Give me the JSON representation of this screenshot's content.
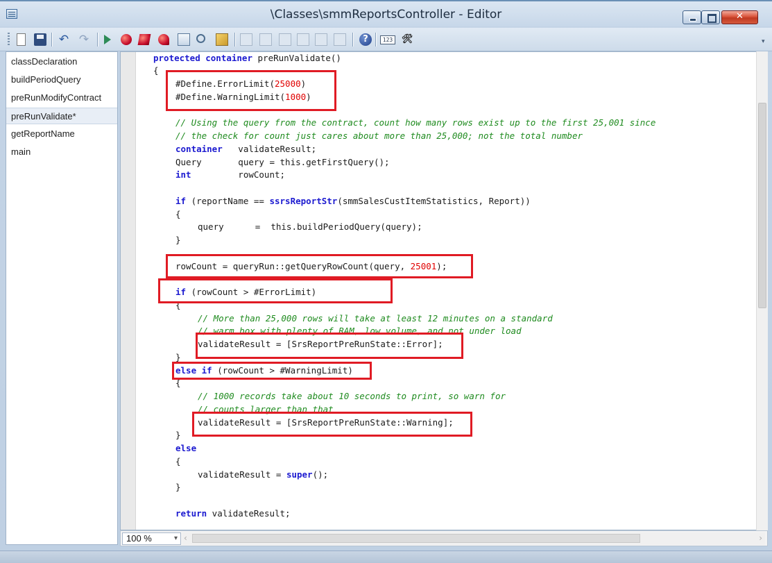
{
  "window": {
    "title": "\\Classes\\smmReportsController - Editor"
  },
  "toolbar": {
    "help_glyph": "?",
    "number_glyph": "123",
    "macro_glyph": "&lt;/&gt;",
    "undo_glyph": "↶",
    "redo_glyph": "↷",
    "overflow_glyph": "▾"
  },
  "methods": [
    {
      "label": "classDeclaration",
      "selected": false
    },
    {
      "label": "buildPeriodQuery",
      "selected": false
    },
    {
      "label": "preRunModifyContract",
      "selected": false
    },
    {
      "label": "preRunValidate*",
      "selected": true
    },
    {
      "label": "getReportName",
      "selected": false
    },
    {
      "label": "main",
      "selected": false
    }
  ],
  "code": {
    "l01_kw": "protected container",
    "l01_rest": " preRunValidate()",
    "l02": "{",
    "l03_a": "#Define.ErrorLimit(",
    "l03_n": "25000",
    "l03_b": ")",
    "l04_a": "#Define.WarningLimit(",
    "l04_n": "1000",
    "l04_b": ")",
    "l06": "// Using the query from the contract, count how many rows exist up to the first 25,001 since",
    "l07": "// the check for count just cares about more than 25,000; not the total number",
    "l08_kw": "container",
    "l08_rest": "   validateResult;",
    "l09": "Query       query = this.getFirstQuery();",
    "l10_kw": "int",
    "l10_rest": "         rowCount;",
    "l12_kw": "if",
    "l12_a": " (reportName == ",
    "l12_kw2": "ssrsReportStr",
    "l12_b": "(smmSalesCustItemStatistics, Report))",
    "l13": "{",
    "l14": "query      =  this.buildPeriodQuery(query);",
    "l15": "}",
    "l17_a": "rowCount = queryRun::getQueryRowCount(query, ",
    "l17_n": "25001",
    "l17_b": ");",
    "l19_kw": "if",
    "l19_rest": " (rowCount > #ErrorLimit)",
    "l20": "{",
    "l21": "// More than 25,000 rows will take at least 12 minutes on a standard",
    "l22": "// warm box with plenty of RAM, low volume, and not under load",
    "l23": "validateResult = [SrsReportPreRunState::Error];",
    "l24": "}",
    "l25_kw": "else if",
    "l25_rest": " (rowCount > #WarningLimit)",
    "l26": "{",
    "l27": "// 1000 records take about 10 seconds to print, so warn for",
    "l28": "// counts larger than that",
    "l29": "validateResult = [SrsReportPreRunState::Warning];",
    "l30": "}",
    "l31_kw": "else",
    "l32": "{",
    "l33_a": "validateResult = ",
    "l33_kw": "super",
    "l33_b": "();",
    "l34": "}",
    "l36_kw": "return",
    "l36_rest": " validateResult;"
  },
  "zoom": {
    "value": "100 %",
    "arrow": "▾"
  },
  "colors": {
    "keyword": "#1c1ad0",
    "comment": "#1f8b1f",
    "number": "#e00000",
    "highlight_box": "#e01b24"
  }
}
